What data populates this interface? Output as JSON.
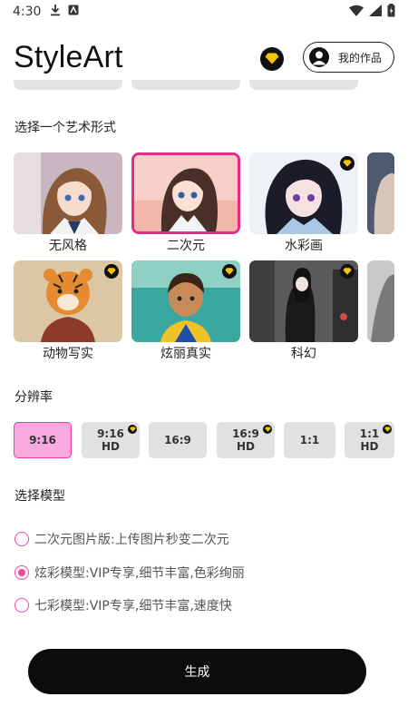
{
  "status_bar": {
    "time": "4:30"
  },
  "header": {
    "app_title": "StyleArt",
    "works_label": "我的作品"
  },
  "art_section": {
    "title": "选择一个艺术形式",
    "cards": [
      {
        "label": "无风格",
        "vip": false,
        "selected": false
      },
      {
        "label": "二次元",
        "vip": false,
        "selected": true
      },
      {
        "label": "水彩画",
        "vip": true,
        "selected": false
      },
      {
        "label": "",
        "vip": false,
        "selected": false
      },
      {
        "label": "动物写实",
        "vip": true,
        "selected": false
      },
      {
        "label": "炫丽真实",
        "vip": true,
        "selected": false
      },
      {
        "label": "科幻",
        "vip": true,
        "selected": false
      },
      {
        "label": "",
        "vip": false,
        "selected": false
      }
    ]
  },
  "resolution": {
    "title": "分辨率",
    "options": [
      {
        "line1": "9:16",
        "line2": "",
        "vip": false,
        "selected": true
      },
      {
        "line1": "9:16",
        "line2": "HD",
        "vip": true,
        "selected": false
      },
      {
        "line1": "16:9",
        "line2": "",
        "vip": false,
        "selected": false
      },
      {
        "line1": "16:9",
        "line2": "HD",
        "vip": true,
        "selected": false
      },
      {
        "line1": "1:1",
        "line2": "",
        "vip": false,
        "selected": false
      },
      {
        "line1": "1:1",
        "line2": "HD",
        "vip": true,
        "selected": false
      }
    ]
  },
  "model": {
    "title": "选择模型",
    "options": [
      {
        "label": "二次元图片版:上传图片秒变二次元",
        "selected": false
      },
      {
        "label": "炫彩模型:VIP专享,细节丰富,色彩绚丽",
        "selected": true
      },
      {
        "label": "七彩模型:VIP专享,细节丰富,速度快",
        "selected": false
      }
    ]
  },
  "generate": {
    "label": "生成"
  },
  "colors": {
    "accent": "#ee3a9c",
    "selected_chip": "#f8a9dd",
    "vip_gold": "#f5c400",
    "button_bg": "#0c0c0c"
  }
}
